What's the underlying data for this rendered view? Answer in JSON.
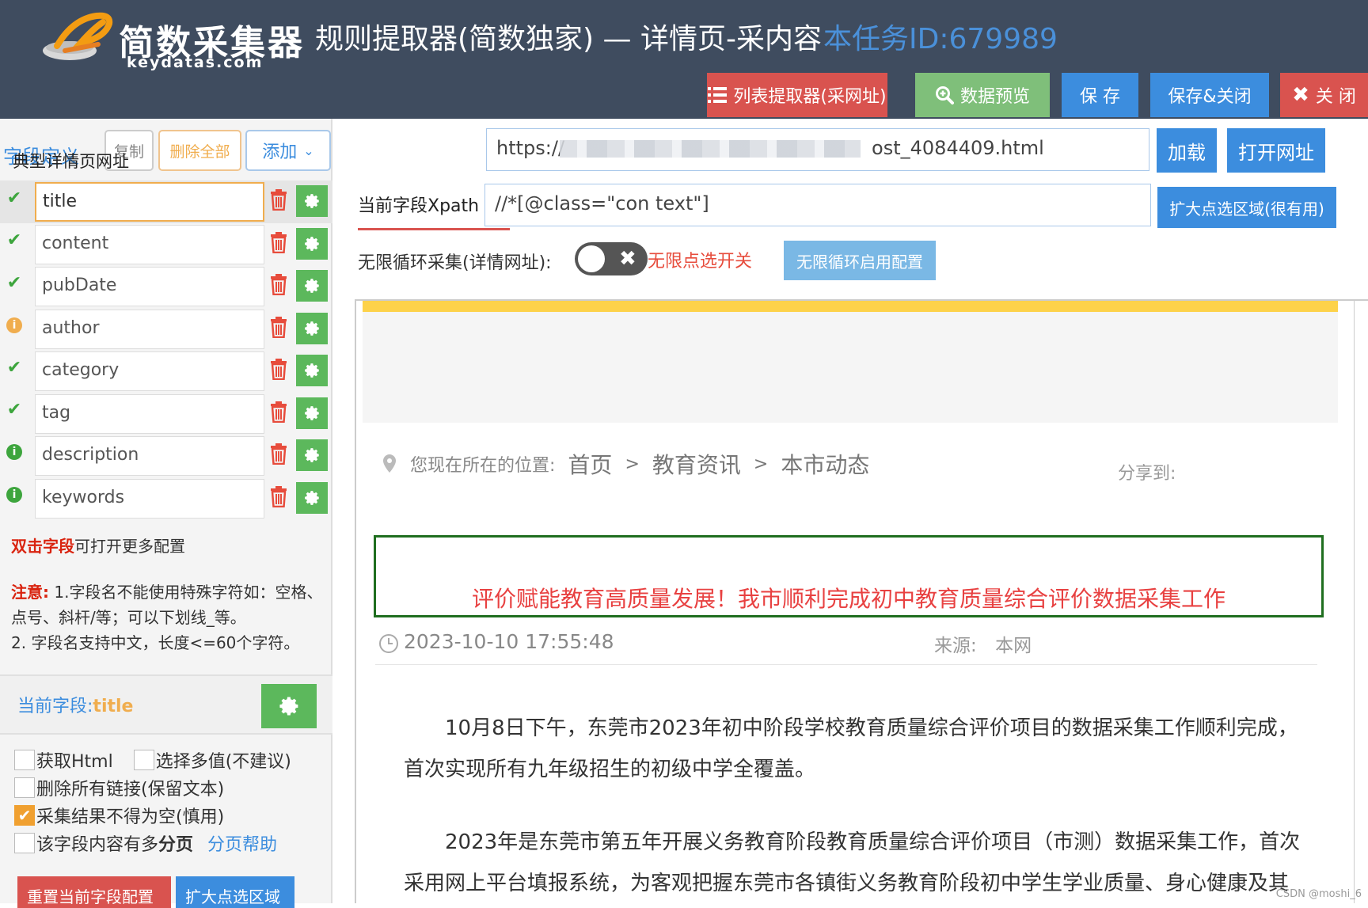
{
  "header": {
    "brand_name": "简数采集器",
    "brand_url": "keydatas.com",
    "page_heading": "规则提取器(简数独家) — 详情页-采内容",
    "task_id": "本任务ID:679989",
    "buttons": {
      "list_extractor": "列表提取器(采网址)",
      "preview": "数据预览",
      "save": "保 存",
      "save_close": "保存&关闭",
      "close": "关 闭"
    }
  },
  "left": {
    "tab_label": "字段定义",
    "copy_label": "复制",
    "delete_all_label": "删除全部",
    "add_label": "添加",
    "fields": [
      {
        "name": "title",
        "status": "ok"
      },
      {
        "name": "content",
        "status": "ok"
      },
      {
        "name": "pubDate",
        "status": "ok"
      },
      {
        "name": "author",
        "status": "warn"
      },
      {
        "name": "category",
        "status": "ok"
      },
      {
        "name": "tag",
        "status": "ok"
      },
      {
        "name": "description",
        "status": "info"
      },
      {
        "name": "keywords",
        "status": "info"
      }
    ],
    "dbl_click_em": "双击字段",
    "dbl_click_rest": "可打开更多配置",
    "notice_em": "注意:",
    "notice_line1": "1.字段名不能使用特殊字符如：空格、点号、斜杆/等；可以下划线_等。",
    "notice_line2": "2. 字段名支持中文，长度<=60个字符。",
    "current_field_prefix": "当前字段:",
    "current_field_value": "title",
    "options": {
      "get_html": "获取Html",
      "multi_value": "选择多值(不建议)",
      "remove_links": "删除所有链接(保留文本)",
      "not_empty": "采集结果不得为空(慎用)",
      "paging_prefix": "该字段内容有多",
      "paging_bold": "分页",
      "paging_help": "分页帮助"
    },
    "reset_label": "重置当前字段配置",
    "expand_label": "扩大点选区域"
  },
  "right": {
    "url_label": "典型详情页网址",
    "url_start": "https://",
    "url_end": "ost_4084409.html",
    "load_label": "加载",
    "open_url_label": "打开网址",
    "xpath_label": "当前字段Xpath",
    "xpath_value": "//*[@class=\"con text\"]",
    "expand_area_label": "扩大点选区域(很有用)",
    "loop_label": "无限循环采集(详情网址):",
    "loop_switch_label": "无限点选开关",
    "loop_config_label": "无限循环启用配置"
  },
  "preview": {
    "breadcrumb_prefix": "您现在所在的位置:",
    "crumbs": [
      "首页",
      "教育资讯",
      "本市动态"
    ],
    "separator": ">",
    "share_label": "分享到:",
    "article_title": "评价赋能教育高质量发展！我市顺利完成初中教育质量综合评价数据采集工作",
    "article_date": "2023-10-10 17:55:48",
    "source_label": "来源:",
    "source_value": "本网",
    "para1": "10月8日下午，东莞市2023年初中阶段学校教育质量综合评价项目的数据采集工作顺利完成，首次实现所有九年级招生的初级中学全覆盖。",
    "para2": "2023年是东莞市第五年开展义务教育阶段教育质量综合评价项目（市测）数据采集工作，首次采用网上平台填报系统，为客观把握东莞市各镇街义务教育阶段初中学生学业质量、身心健康及其"
  },
  "watermark": "CSDN @moshi_6",
  "colors": {
    "header_bg": "#3f4c5f",
    "accent_blue": "#3c8dde",
    "danger_red": "#d9534f",
    "success_green": "#5cb85c",
    "warning_orange": "#f0ad4e"
  }
}
